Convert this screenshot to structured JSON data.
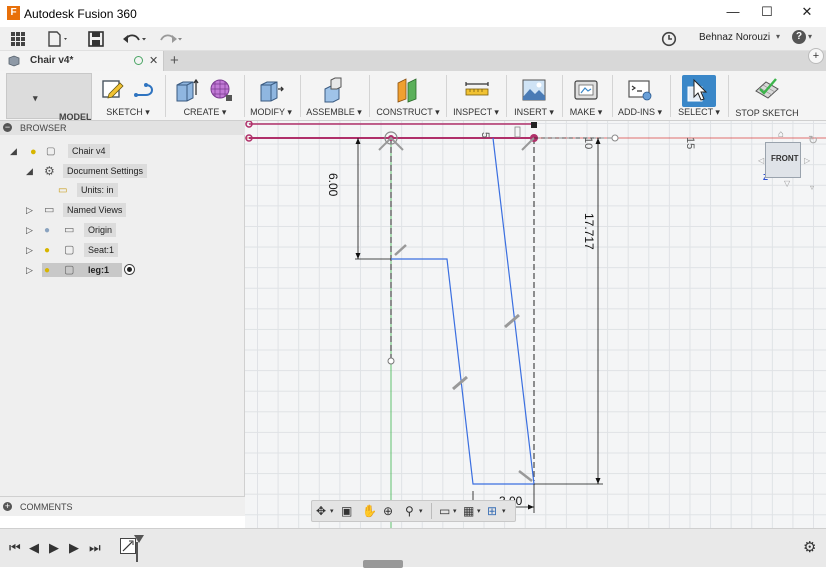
{
  "app": {
    "title": "Autodesk Fusion 360",
    "icon_letter": "F",
    "window_controls": {
      "minimize": "—",
      "maximize": "☐",
      "close": "✕"
    }
  },
  "quick_access": {
    "user_name": "Behnaz Norouzi",
    "help_label": "?"
  },
  "document_tab": {
    "name": "Chair v4*",
    "close_label": "✕",
    "new_tab_label": "+"
  },
  "ribbon": {
    "workspace_label": "MODEL",
    "groups": [
      {
        "id": "sketch",
        "label": "SKETCH ▾"
      },
      {
        "id": "create",
        "label": "CREATE ▾"
      },
      {
        "id": "modify",
        "label": "MODIFY ▾"
      },
      {
        "id": "assemble",
        "label": "ASSEMBLE ▾"
      },
      {
        "id": "construct",
        "label": "CONSTRUCT ▾"
      },
      {
        "id": "inspect",
        "label": "INSPECT ▾"
      },
      {
        "id": "insert",
        "label": "INSERT ▾"
      },
      {
        "id": "make",
        "label": "MAKE ▾"
      },
      {
        "id": "addins",
        "label": "ADD-INS ▾"
      },
      {
        "id": "select",
        "label": "SELECT ▾"
      },
      {
        "id": "stop_sketch",
        "label": "STOP SKETCH"
      }
    ],
    "accent": "#3a87c8"
  },
  "browser": {
    "header": "BROWSER",
    "nodes": [
      {
        "label": "Chair v4"
      },
      {
        "label": "Document Settings"
      },
      {
        "label": "Units: in"
      },
      {
        "label": "Named Views"
      },
      {
        "label": "Origin"
      },
      {
        "label": "Seat:1"
      },
      {
        "label": "leg:1"
      }
    ]
  },
  "comments": {
    "label": "COMMENTS"
  },
  "viewcube": {
    "label": "FRONT",
    "axis_z": "Z",
    "axis_x": "X"
  },
  "sketch": {
    "dimensions": {
      "left_vertical": "6.00",
      "right_vertical": "17.717",
      "bottom_horizontal": "3.00"
    },
    "ruler_labels": [
      "5",
      "10",
      "15"
    ],
    "colors": {
      "profile": "#3b6fe0",
      "construction": "#555555",
      "dimension": "#111111",
      "plane_line": "#b0306a",
      "axis_green": "#3cb44b",
      "axis_red": "#d84040"
    }
  }
}
